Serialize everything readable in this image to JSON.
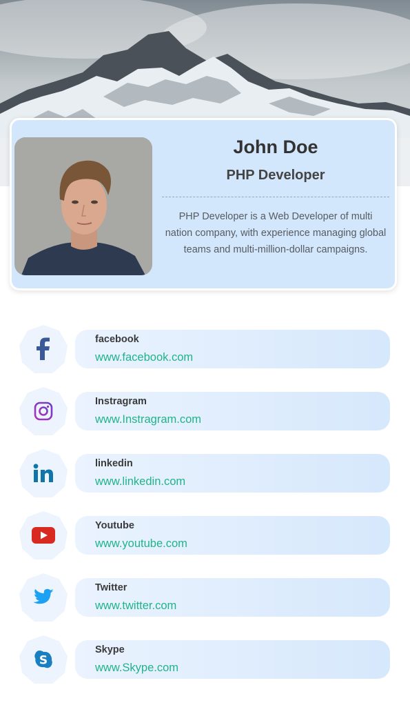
{
  "profile": {
    "name": "John Doe",
    "title": "PHP Developer",
    "bio": "PHP Developer is a Web Developer of multi nation company, with experience managing global teams and multi-million-dollar campaigns."
  },
  "social": [
    {
      "icon": "facebook-icon",
      "label": "facebook",
      "url": "www.facebook.com",
      "color": "#3b5998"
    },
    {
      "icon": "instagram-icon",
      "label": "Instragram",
      "url": "www.Instragram.com",
      "color": "#8a3ab9"
    },
    {
      "icon": "linkedin-icon",
      "label": "linkedin",
      "url": "www.linkedin.com",
      "color": "#0e76a8"
    },
    {
      "icon": "youtube-icon",
      "label": "Youtube",
      "url": "www.youtube.com",
      "color": "#d82a20"
    },
    {
      "icon": "twitter-icon",
      "label": "Twitter",
      "url": "www.twitter.com",
      "color": "#1da1f2"
    },
    {
      "icon": "skype-icon",
      "label": "Skype",
      "url": "www.Skype.com",
      "color": "#1a7fc1"
    }
  ],
  "colors": {
    "card_background": "#d3e7fc",
    "link": "#20b38a",
    "hex_background": "#edf4fd"
  }
}
